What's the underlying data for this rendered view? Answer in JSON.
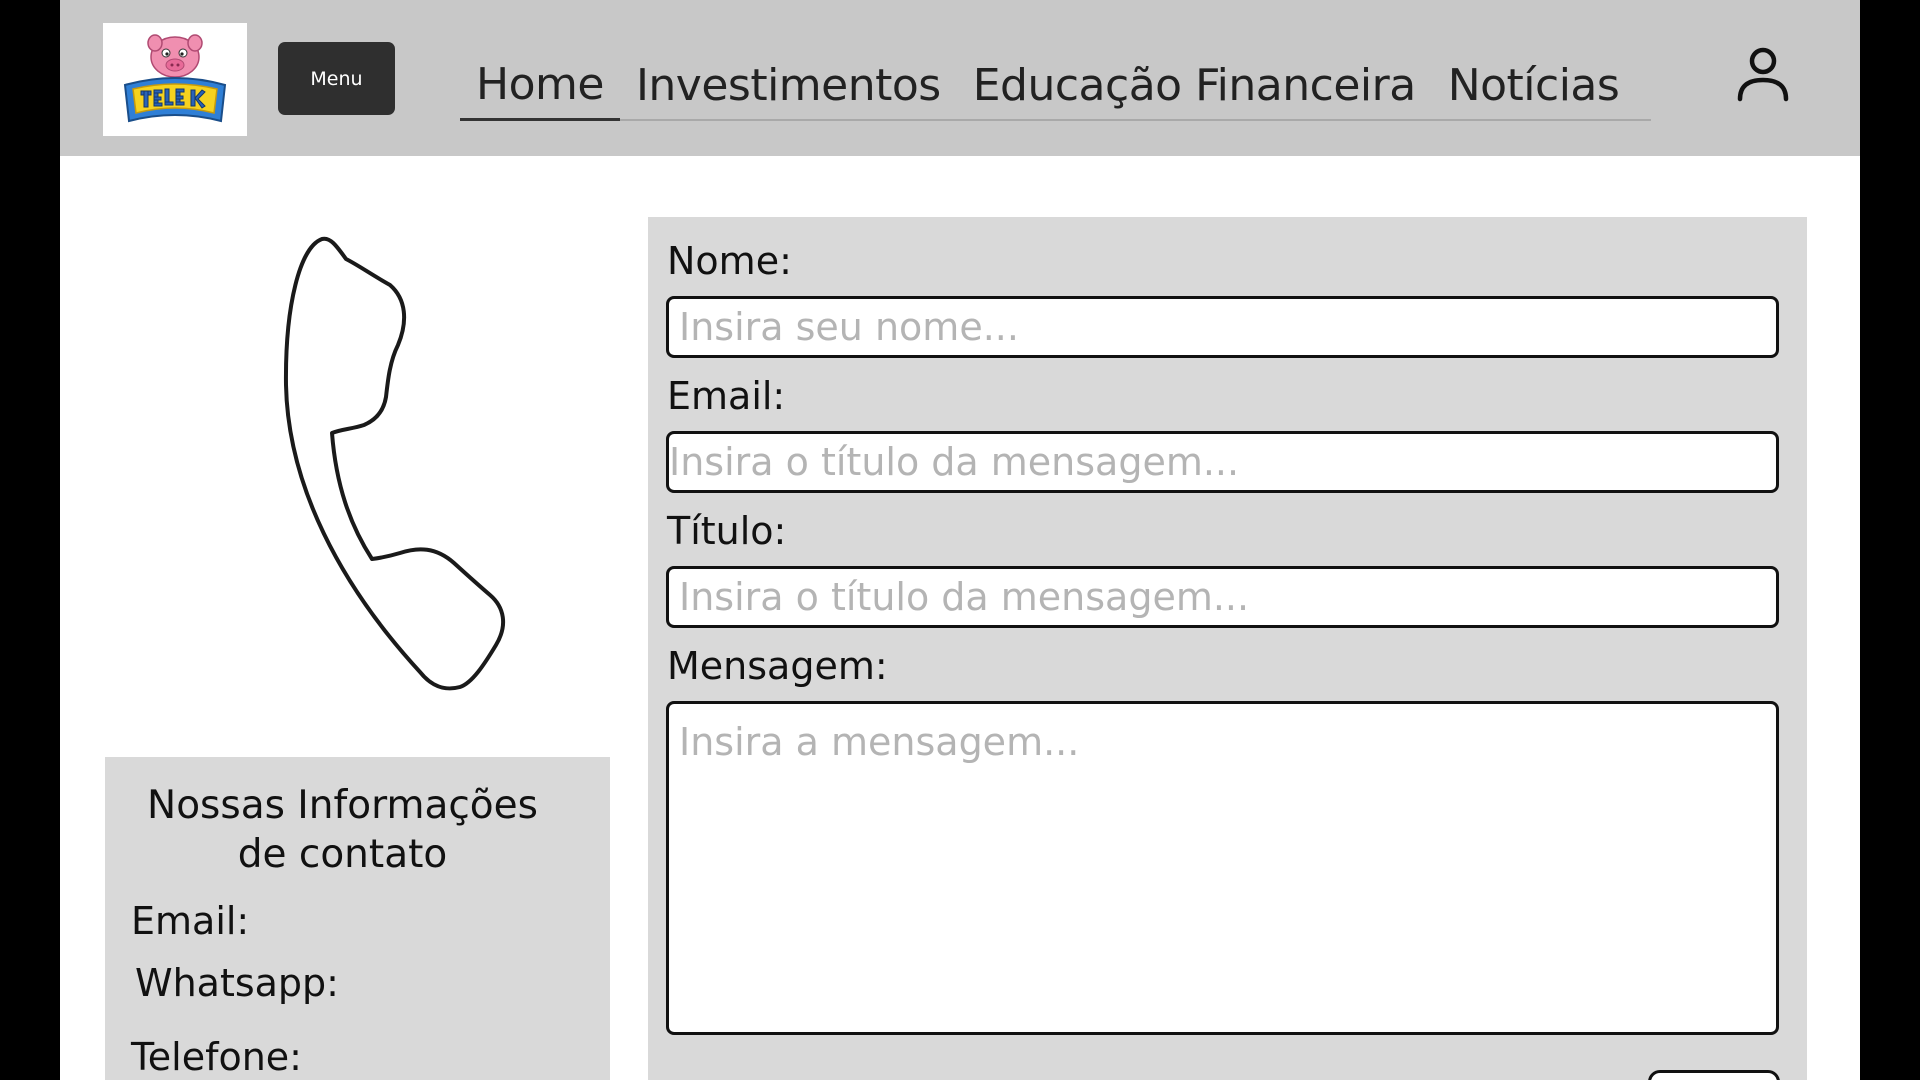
{
  "header": {
    "logo_alt": "TELE KID",
    "menu_label": "Menu",
    "nav": [
      {
        "label": "Home",
        "active": true
      },
      {
        "label": "Investimentos",
        "active": false
      },
      {
        "label": "Educação Financeira",
        "active": false
      },
      {
        "label": "Notícias",
        "active": false
      }
    ],
    "user_icon": "user-icon"
  },
  "illustration": {
    "icon": "phone-handset-icon"
  },
  "contact_info": {
    "title_line1": "Nossas Informações",
    "title_line2": "de contato",
    "email_label": "Email:",
    "whatsapp_label": "Whatsapp:",
    "telefone_label": "Telefone:"
  },
  "form": {
    "name_label": "Nome:",
    "name_placeholder": "Insira seu nome...",
    "email_label": "Email:",
    "email_placeholder": "Insira o título da mensagem...",
    "title_label": "Título:",
    "title_placeholder": "Insira o título da mensagem...",
    "message_label": "Mensagem:",
    "message_placeholder": "Insira a mensagem..."
  },
  "colors": {
    "header_bg": "#c8c8c8",
    "panel_bg": "#d9d9d9",
    "menu_button_bg": "#2f2f2f",
    "page_bg": "#ffffff",
    "side_bars": "#000000"
  }
}
